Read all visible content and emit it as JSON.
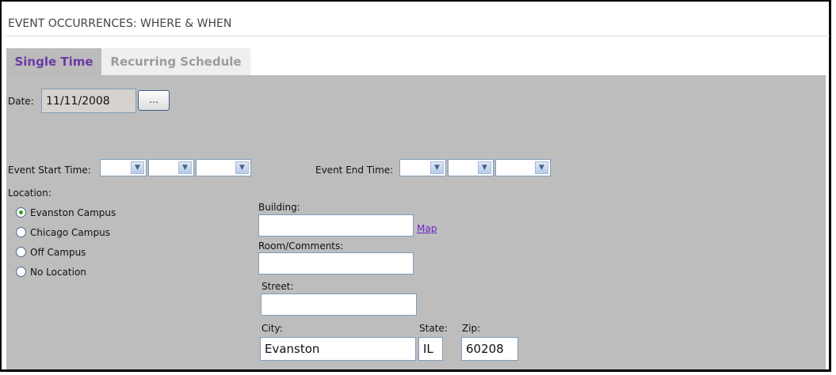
{
  "page": {
    "header_title": "EVENT OCCURRENCES: WHERE & WHEN"
  },
  "tabs": [
    {
      "label": "Single Time"
    },
    {
      "label": "Recurring Schedule"
    }
  ],
  "date": {
    "label": "Date:",
    "value": "11/11/2008",
    "button_label": "..."
  },
  "time": {
    "start_label": "Event Start Time:",
    "end_label": "Event End Time:"
  },
  "location": {
    "label": "Location:",
    "options": [
      {
        "label": "Evanston Campus",
        "checked": true
      },
      {
        "label": "Chicago Campus",
        "checked": false
      },
      {
        "label": "Off Campus",
        "checked": false
      },
      {
        "label": "No Location",
        "checked": false
      }
    ]
  },
  "address": {
    "building_label": "Building:",
    "map_link": "Map",
    "room_label": "Room/Comments:",
    "street_label": "Street:",
    "city_label": "City:",
    "state_label": "State:",
    "zip_label": "Zip:",
    "city_value": "Evanston",
    "state_value": "IL",
    "zip_value": "60208"
  }
}
